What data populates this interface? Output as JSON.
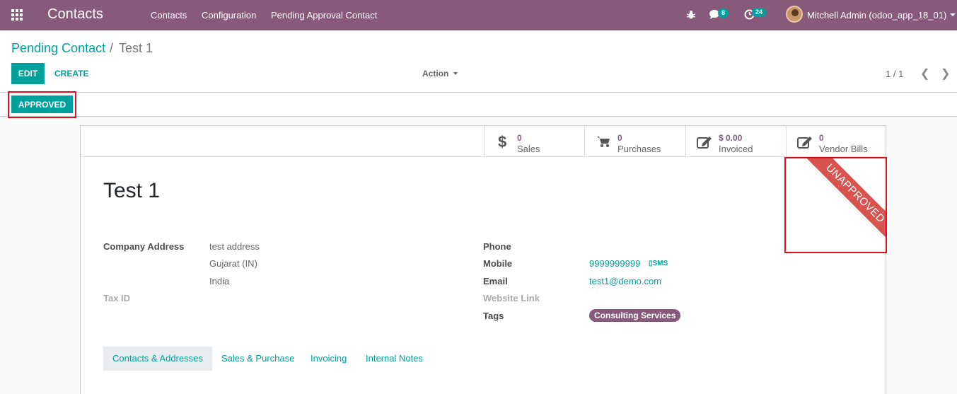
{
  "navbar": {
    "app_title": "Contacts",
    "menu": [
      "Contacts",
      "Configuration",
      "Pending Approval Contact"
    ],
    "messages_count": "8",
    "activities_count": "24",
    "user": "Mitchell Admin (odoo_app_18_01)",
    "icons": [
      "apps-icon",
      "bug-icon",
      "chat-icon",
      "clock-icon"
    ]
  },
  "breadcrumb": {
    "root": "Pending Contact",
    "separator": "/",
    "current": "Test 1"
  },
  "toolbar": {
    "edit_label": "EDIT",
    "create_label": "CREATE",
    "action_label": "Action",
    "pager": "1 / 1"
  },
  "statusbar": {
    "approved_label": "APPROVED"
  },
  "stat_buttons": [
    {
      "value": "0",
      "label": "Sales",
      "icon": "dollar-icon"
    },
    {
      "value": "0",
      "label": "Purchases",
      "icon": "cart-icon"
    },
    {
      "value": "$ 0.00",
      "label": "Invoiced",
      "icon": "edit-icon"
    },
    {
      "value": "0",
      "label": "Vendor Bills",
      "icon": "edit-icon"
    }
  ],
  "record": {
    "name": "Test 1",
    "ribbon": "UNAPPROVED",
    "company_address_label": "Company Address",
    "address_lines": [
      "test address",
      "Gujarat (IN)",
      "India"
    ],
    "tax_id_label": "Tax ID",
    "phone_label": "Phone",
    "mobile_label": "Mobile",
    "mobile": "9999999999",
    "sms_label": "SMS",
    "email_label": "Email",
    "email": "test1@demo.com",
    "website_label": "Website Link",
    "tags_label": "Tags",
    "tags": [
      "Consulting Services"
    ]
  },
  "tabs": [
    "Contacts & Addresses",
    "Sales & Purchase",
    "Invoicing",
    "Internal Notes"
  ],
  "colors": {
    "brand": "#875a7b",
    "accent": "#00a09d",
    "ribbon": "#d9534f",
    "highlight": "#e0101e"
  }
}
